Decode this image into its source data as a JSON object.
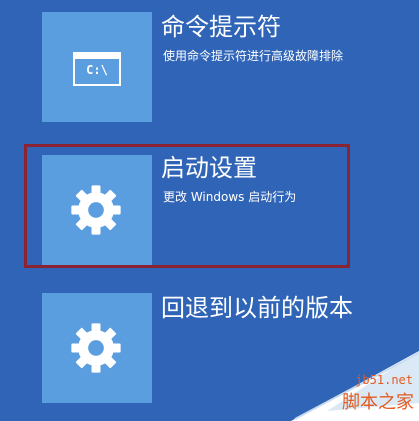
{
  "options": [
    {
      "id": "command-prompt",
      "title": "命令提示符",
      "description": "使用命令提示符进行高级故障排除",
      "icon": "command-prompt-icon",
      "icon_text": "C:\\"
    },
    {
      "id": "startup-settings",
      "title": "启动设置",
      "description": "更改 Windows 启动行为",
      "icon": "gear-icon",
      "selected": true
    },
    {
      "id": "rollback",
      "title": "回退到以前的版本",
      "description": "",
      "icon": "gear-icon"
    }
  ],
  "watermark": {
    "domain": "jb51.net",
    "name": "脚本之家"
  },
  "colors": {
    "background": "#2f64b7",
    "tile": "#5b9ee0",
    "text": "#ffffff",
    "selection_frame": "#8c2332",
    "watermark_text": "#e35b1f"
  }
}
